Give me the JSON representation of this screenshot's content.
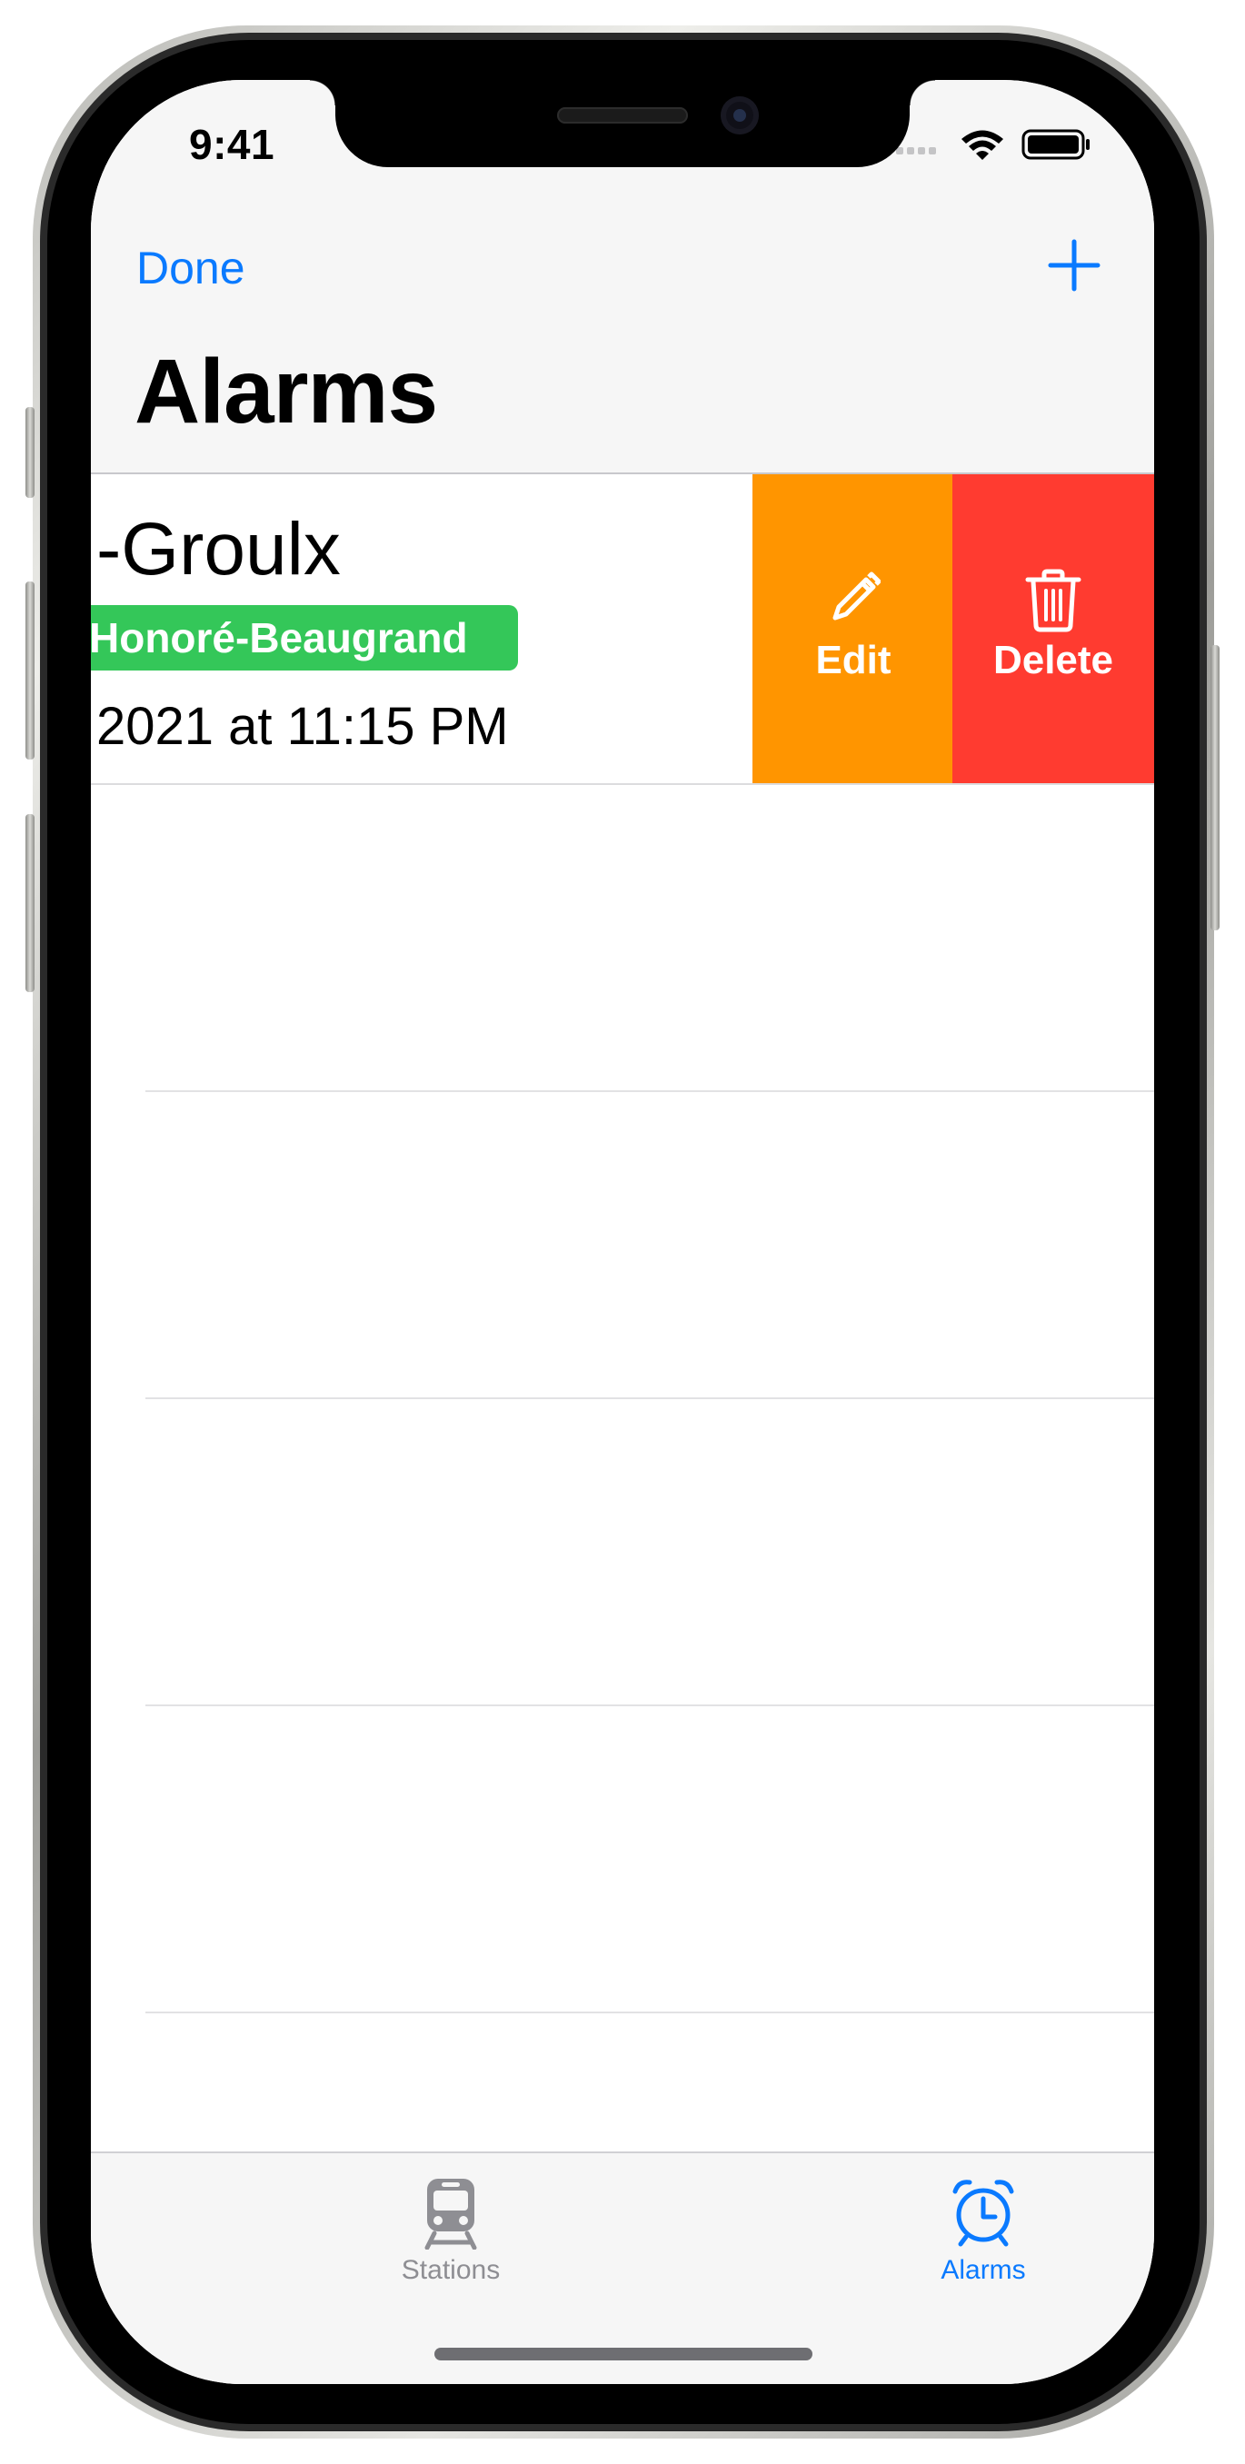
{
  "status_bar": {
    "time": "9:41",
    "icons": [
      "signal-icon",
      "wifi-icon",
      "battery-icon"
    ]
  },
  "nav": {
    "left_button": "Done",
    "right_button_icon": "plus-icon",
    "title": "Alarms"
  },
  "alarm_row": {
    "title": "-Groulx",
    "line_badge": "Honoré-Beaugrand",
    "line_badge_color": "#34c759",
    "date": "2021 at 11:15 PM",
    "actions": [
      {
        "label": "Edit",
        "icon": "pencil-icon",
        "color": "#ff9500"
      },
      {
        "label": "Delete",
        "icon": "trash-icon",
        "color": "#ff3b30"
      }
    ]
  },
  "tab_bar": {
    "tabs": [
      {
        "label": "Stations",
        "icon": "train-icon",
        "selected": false
      },
      {
        "label": "Alarms",
        "icon": "alarm-clock-icon",
        "selected": true
      }
    ]
  },
  "colors": {
    "accent": "#0a7aff",
    "edit": "#ff9500",
    "delete": "#ff3b30",
    "badge": "#34c759"
  }
}
